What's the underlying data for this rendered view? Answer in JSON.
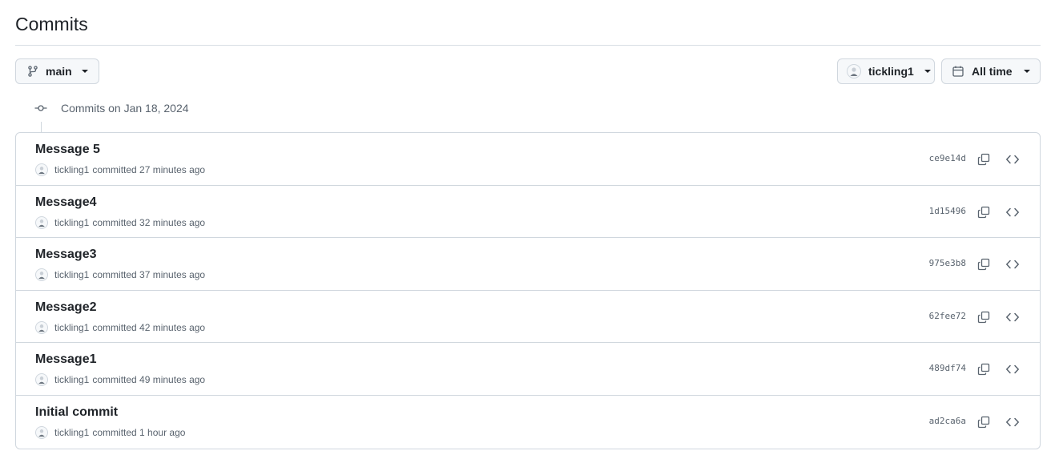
{
  "header": {
    "title": "Commits"
  },
  "filters": {
    "branch": {
      "label": "main",
      "icon": "git-branch-icon"
    },
    "author": {
      "label": "tickling1",
      "icon": "avatar"
    },
    "time": {
      "label": "All time",
      "icon": "calendar-icon"
    }
  },
  "group": {
    "label": "Commits on Jan 18, 2024",
    "icon": "git-commit-icon"
  },
  "commits": [
    {
      "message": "Message 5",
      "author": "tickling1",
      "meta": "committed 27 minutes ago",
      "sha": "ce9e14d"
    },
    {
      "message": "Message4",
      "author": "tickling1",
      "meta": "committed 32 minutes ago",
      "sha": "1d15496"
    },
    {
      "message": "Message3",
      "author": "tickling1",
      "meta": "committed 37 minutes ago",
      "sha": "975e3b8"
    },
    {
      "message": "Message2",
      "author": "tickling1",
      "meta": "committed 42 minutes ago",
      "sha": "62fee72"
    },
    {
      "message": "Message1",
      "author": "tickling1",
      "meta": "committed 49 minutes ago",
      "sha": "489df74"
    },
    {
      "message": "Initial commit",
      "author": "tickling1",
      "meta": "committed 1 hour ago",
      "sha": "ad2ca6a"
    }
  ],
  "colors": {
    "border": "#d0d7de",
    "text": "#1f2328",
    "muted": "#59636e",
    "button_bg": "#f6f8fa"
  }
}
